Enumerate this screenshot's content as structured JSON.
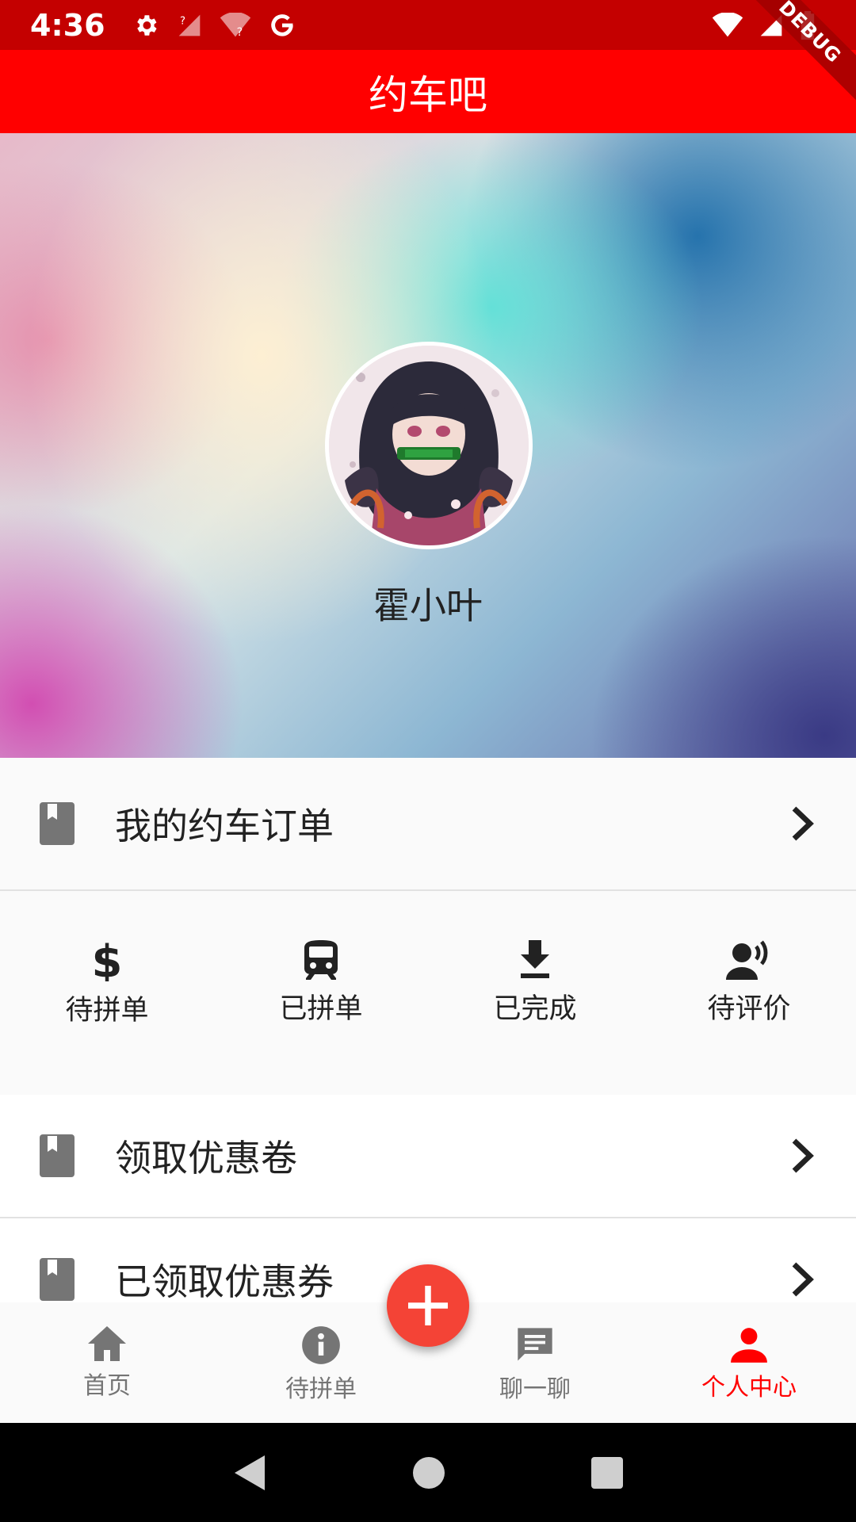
{
  "status_bar": {
    "time": "4:36"
  },
  "app_bar": {
    "title": "约车吧",
    "debug_banner": "DEBUG"
  },
  "profile": {
    "username": "霍小叶"
  },
  "menu": {
    "orders_label": "我的约车订单",
    "coupons_label": "领取优惠卷",
    "claimed_coupons_label": "已领取优惠券"
  },
  "order_status": [
    {
      "label": "待拼单",
      "icon": "dollar-icon"
    },
    {
      "label": "已拼单",
      "icon": "train-icon"
    },
    {
      "label": "已完成",
      "icon": "download-icon"
    },
    {
      "label": "待评价",
      "icon": "record-voice-icon"
    }
  ],
  "bottom_nav": [
    {
      "label": "首页",
      "icon": "home-icon"
    },
    {
      "label": "待拼单",
      "icon": "info-icon"
    },
    {
      "label": "聊一聊",
      "icon": "chat-icon"
    },
    {
      "label": "个人中心",
      "icon": "person-icon",
      "active": true
    }
  ],
  "colors": {
    "app_bar": "#ff0000",
    "status_bar": "#c40000",
    "fab": "#f44336",
    "active_nav": "#ff0000",
    "inactive_nav": "#757575"
  }
}
